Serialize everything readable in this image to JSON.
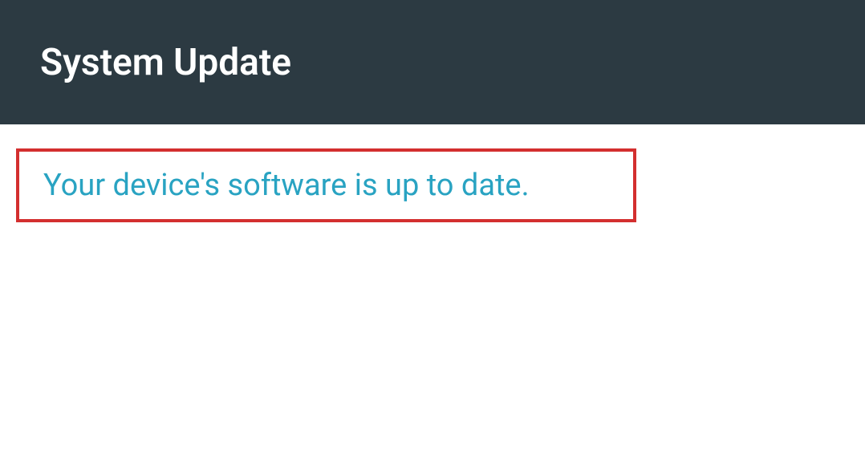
{
  "header": {
    "title": "System Update"
  },
  "content": {
    "status_message": "Your device's software is up to date."
  },
  "colors": {
    "header_bg": "#2c3a42",
    "status_text": "#29a3c2",
    "highlight_border": "#d32f2f"
  }
}
